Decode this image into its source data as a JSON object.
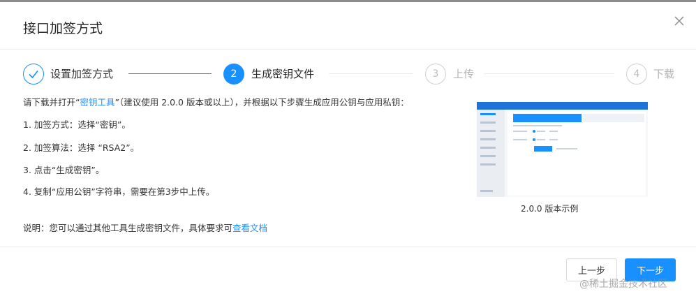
{
  "dialog": {
    "title": "接口加签方式"
  },
  "steps": [
    {
      "number": "1",
      "label": "设置加签方式",
      "status": "done"
    },
    {
      "number": "2",
      "label": "生成密钥文件",
      "status": "active"
    },
    {
      "number": "3",
      "label": "上传",
      "status": "wait"
    },
    {
      "number": "4",
      "label": "下载",
      "status": "wait"
    }
  ],
  "instructions": {
    "intro_before": "请下载并打开“",
    "intro_link": "密钥工具",
    "intro_after": "”（建议使用 2.0.0 版本或以上），并根据以下步骤生成应用公钥与应用私钥：",
    "items": [
      "1. 加签方式：选择“密钥”。",
      "2. 加签算法：选择 “RSA2”。",
      "3. 点击“生成密钥”。",
      "4. 复制“应用公钥”字符串，需要在第3步中上传。"
    ],
    "note_before": "说明：您可以通过其他工具生成密钥文件，具体要求可",
    "note_link": "查看文档"
  },
  "example": {
    "caption": "2.0.0 版本示例"
  },
  "footer": {
    "prev_label": "上一步",
    "next_label": "下一步"
  },
  "watermark": "@稀土掘金技术社区",
  "colors": {
    "primary": "#1890ff",
    "wait": "#bdbdbd"
  }
}
